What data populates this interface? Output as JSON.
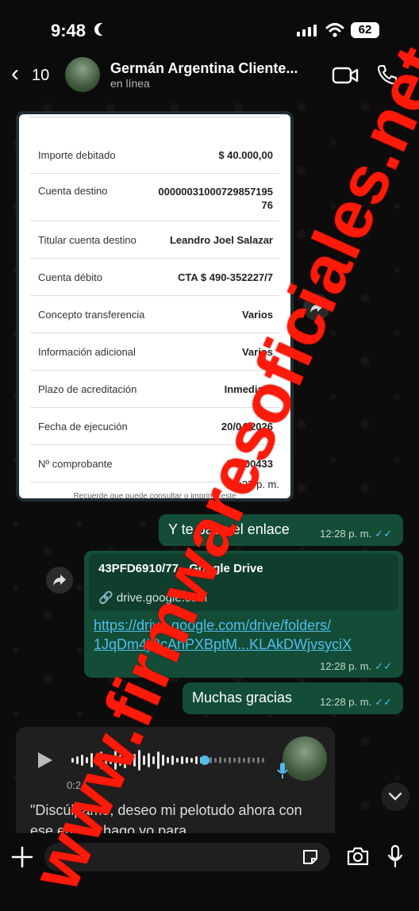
{
  "status_bar": {
    "time": "9:48",
    "battery": "62"
  },
  "header": {
    "back_count": "10",
    "contact_name": "Germán Argentina Cliente...",
    "status": "en línea"
  },
  "receipt": {
    "rows": [
      {
        "label": "Importe debitado",
        "value": "$ 40.000,00"
      },
      {
        "label": "Cuenta destino",
        "value": "0000003100072985719576"
      },
      {
        "label": "Titular cuenta destino",
        "value": "Leandro Joel Salazar"
      },
      {
        "label": "Cuenta débito",
        "value": "CTA $ 490-352227/7"
      },
      {
        "label": "Concepto transferencia",
        "value": "Varios"
      },
      {
        "label": "Información adicional",
        "value": "Varios"
      },
      {
        "label": "Plazo de acreditación",
        "value": "Inmediato"
      },
      {
        "label": "Fecha de ejecución",
        "value": "20/04/2026"
      },
      {
        "label": "Nº comprobante",
        "value": "74900433"
      }
    ],
    "footer_note": "Recuerde que puede consultar o imprimir este",
    "time": "12:27 p. m."
  },
  "messages": {
    "link_intro": {
      "text": "Y te paso el enlace",
      "time": "12:28 p. m."
    },
    "link": {
      "title": "43PFD6910/77 - Google Drive",
      "domain": "drive.google.com",
      "url_line1": "https://drive.google.com/drive/folders/",
      "url_line2": "1JqDm4jRcAhPXBptM...KLAkDWjvsyciX",
      "time": "12:28 p. m."
    },
    "thanks": {
      "text": "Muchas gracias",
      "time": "12:28 p. m."
    }
  },
  "voice": {
    "duration": "0:24",
    "transcript": "\"Discúlpame, deseo mi pelotudo ahora con ese enlace hago yo para"
  },
  "watermark": "www.firmwaresoficiales.net",
  "colors": {
    "outgoing_bubble": "#134d37",
    "link": "#53bdeb",
    "watermark": "#ff1a0a"
  }
}
